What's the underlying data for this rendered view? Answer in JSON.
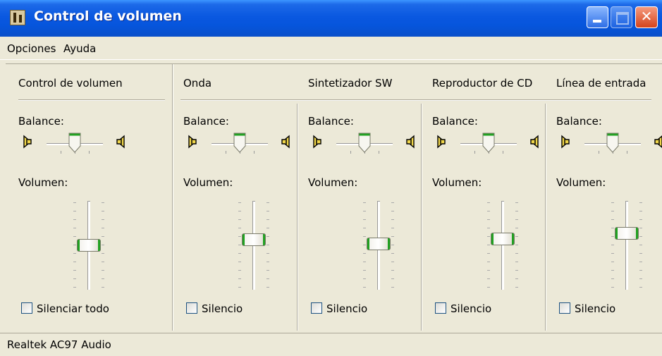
{
  "window": {
    "title": "Control de volumen"
  },
  "menu": [
    "Opciones",
    "Ayuda"
  ],
  "balance_label": "Balance:",
  "volume_label": "Volumen:",
  "columns": [
    {
      "title": "Control de volumen",
      "mute_label": "Silenciar todo",
      "muted": false,
      "balance": 0.5,
      "volume": 0.48
    },
    {
      "title": "Onda",
      "mute_label": "Silencio",
      "muted": false,
      "balance": 0.5,
      "volume": 0.55
    },
    {
      "title": "Sintetizador SW",
      "mute_label": "Silencio",
      "muted": false,
      "balance": 0.5,
      "volume": 0.5
    },
    {
      "title": "Reproductor de CD",
      "mute_label": "Silencio",
      "muted": false,
      "balance": 0.5,
      "volume": 0.56
    },
    {
      "title": "Línea de entrada",
      "mute_label": "Silencio",
      "muted": false,
      "balance": 0.5,
      "volume": 0.63
    }
  ],
  "status": {
    "device": "Realtek AC97 Audio"
  },
  "colors": {
    "titlebar": "#0a58e0",
    "face": "#ece9d8",
    "thumb_accent": "#21a121",
    "close": "#d4431c"
  }
}
